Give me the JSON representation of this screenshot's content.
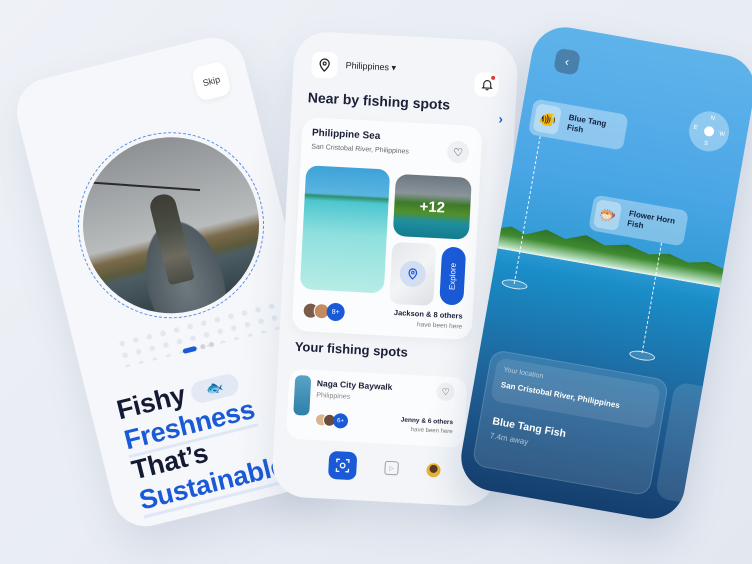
{
  "onboarding": {
    "skip_label": "Skip",
    "pager": {
      "total": 3,
      "active": 1
    },
    "headline": {
      "line1": "Fishy",
      "line2": "Freshness",
      "line3": "That’s",
      "line4": "Sustainable."
    },
    "fish_chip_icon": "🐟",
    "next_icon": "›"
  },
  "home": {
    "location": "Philippines",
    "location_caret": "▾",
    "nearby_title": "Near by fishing spots",
    "see_all_icon": "›",
    "featured_spot": {
      "name": "Philippine Sea",
      "address": "San Cristobal River, Philippines",
      "extra_photos": "+12",
      "explore_label": "Explore",
      "visitors_count": "8+",
      "visitors_main": "Jackson & 8 others",
      "visitors_sub": "have been here"
    },
    "favorite_title": "Your fishing spots",
    "favorite_spot": {
      "name": "Naga City Baywalk",
      "address": "Philippines",
      "visitors_count": "6+",
      "visitors_main": "Jenny & 6 others",
      "visitors_sub": "have been here"
    },
    "tabbar": [
      "scan",
      "video",
      "profile"
    ]
  },
  "ar_view": {
    "back_icon": "‹",
    "compass": {
      "n": "N",
      "s": "S",
      "e": "E",
      "w": "W"
    },
    "fish_tags": [
      {
        "name": "Blue Tang Fish",
        "icon": "🐠"
      },
      {
        "name": "Flower Horn Fish",
        "icon": "🐡"
      }
    ],
    "your_location_label": "Your location",
    "your_location": "San Cristobal River, Philippines",
    "nearest_fish": "Blue Tang Fish",
    "nearest_distance": "7.4m away"
  }
}
